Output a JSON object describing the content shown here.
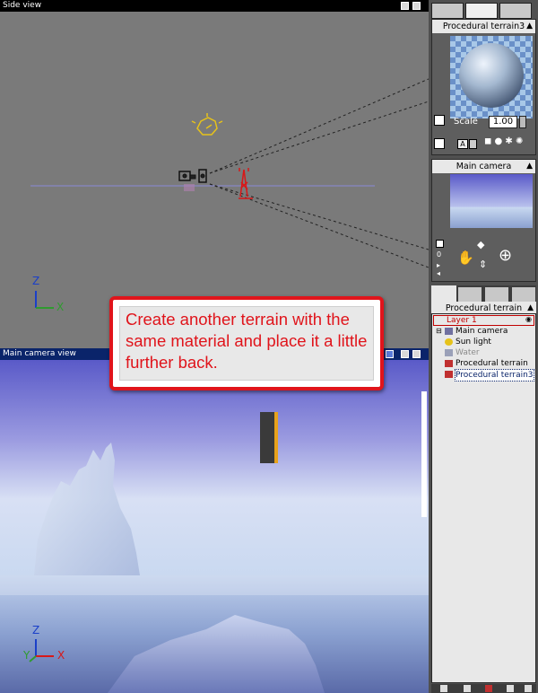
{
  "side_view": {
    "title": "Side view",
    "axis_z": "Z",
    "axis_x": "X"
  },
  "camera_view": {
    "title": "Main camera view",
    "axis_z": "Z",
    "axis_y": "Y",
    "axis_x": "X"
  },
  "material_panel": {
    "title": "Procedural terrain3",
    "scale_label": "Scale",
    "scale_value": "1.00",
    "mode_letter": "A"
  },
  "camera_panel": {
    "title": "Main camera",
    "counter": "0"
  },
  "world_browser": {
    "title": "Procedural terrain",
    "items": [
      {
        "label": "Layer 1",
        "kind": "layer"
      },
      {
        "label": "Main camera",
        "kind": "camera"
      },
      {
        "label": "Sun light",
        "kind": "light"
      },
      {
        "label": "Water",
        "kind": "water"
      },
      {
        "label": "Procedural terrain",
        "kind": "terrain"
      },
      {
        "label": "Procedural terrain3",
        "kind": "terrain",
        "selected": true
      }
    ]
  },
  "callout": {
    "text": "Create another terrain with the same material and place it a little further back."
  },
  "colors": {
    "callout_border": "#e0141b",
    "active_title": "#0a246a"
  }
}
